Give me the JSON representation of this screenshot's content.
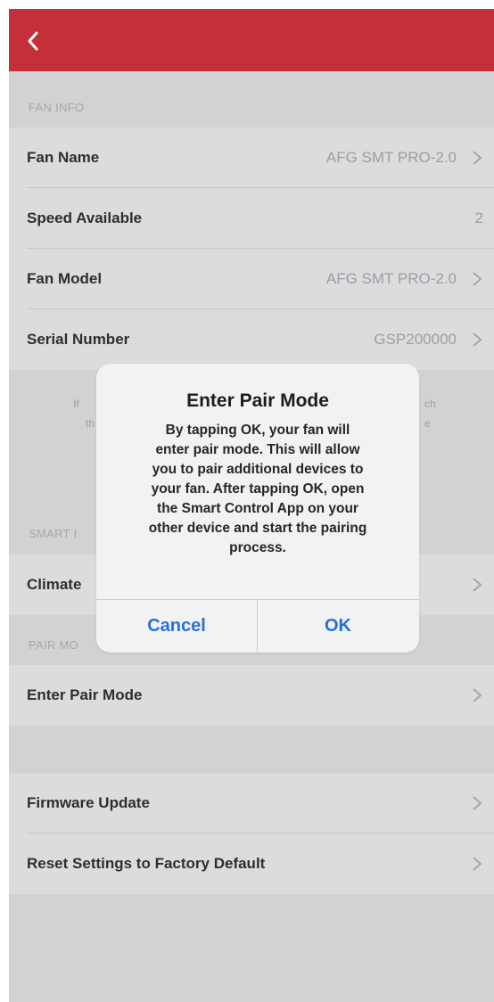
{
  "colors": {
    "navbar": "#c42f3a",
    "background": "#d2d2d4",
    "row": "#dcdcde",
    "alert_button": "#2672d8"
  },
  "navbar": {
    "back_icon": "chevron-left-icon"
  },
  "sections": {
    "fan_info_header": "FAN INFO",
    "smart_header": "SMART I",
    "pair_header": "PAIR MO"
  },
  "fan_info": [
    {
      "label": "Fan Name",
      "value": "AFG SMT PRO-2.0"
    },
    {
      "label": "Speed Available",
      "value": "2"
    },
    {
      "label": "Fan Model",
      "value": "AFG SMT PRO-2.0"
    },
    {
      "label": "Serial Number",
      "value": "GSP200000"
    }
  ],
  "footnote": {
    "left_1": "If",
    "left_2": "th",
    "right_1": "ch",
    "right_2": "e"
  },
  "smart_row": {
    "label": "Climate"
  },
  "pair_row": {
    "label": "Enter Pair Mode"
  },
  "bottom_rows": [
    {
      "label": "Firmware Update"
    },
    {
      "label": "Reset Settings to Factory Default"
    }
  ],
  "alert": {
    "title": "Enter Pair Mode",
    "message_lines": [
      "By tapping OK, your fan will",
      "enter pair mode. This will allow",
      "you to pair additional devices to",
      "your fan. After tapping OK, open",
      "the Smart Control App on your",
      "other device and start the pairing",
      "process."
    ],
    "cancel_label": "Cancel",
    "ok_label": "OK"
  }
}
